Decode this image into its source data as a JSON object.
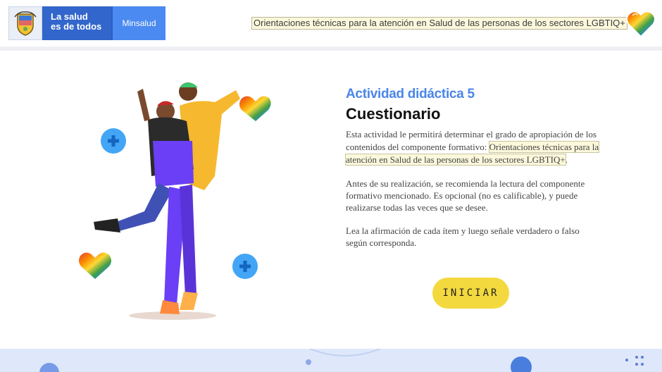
{
  "header": {
    "logo_line1": "La salud",
    "logo_line2": "es de todos",
    "logo_ministry": "Minsalud",
    "course_title": "Orientaciones técnicas para la atención en Salud de las personas de los sectores LGBTIQ+"
  },
  "content": {
    "kicker": "Actividad didáctica 5",
    "title": "Cuestionario",
    "para1_text": "Esta actividad le permitirá determinar el grado de apropiación de los contenidos del componente formativo:",
    "para1_link": "Orientaciones técnicas para la atención en Salud de las personas de los sectores LGBTIQ+",
    "para1_end": ".",
    "para2": "Antes de su realización, se recomienda la lectura del componente formativo mencionado. Es opcional (no es calificable), y puede realizarse todas las veces que se desee.",
    "para3": "Lea la afirmación de cada ítem y luego señale verdadero o falso según corresponda.",
    "start_label": "INICIAR"
  },
  "colors": {
    "accent_blue": "#4a86e8",
    "brand_blue": "#3366cc",
    "button_yellow": "#f4d93e",
    "highlight": "#fbf8dc"
  },
  "icons": [
    "coat-of-arms-icon",
    "rainbow-heart-icon",
    "heart-menu-icon"
  ]
}
